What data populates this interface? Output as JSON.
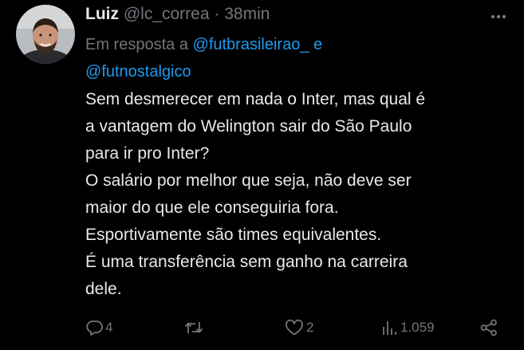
{
  "tweet": {
    "author_name": "Luiz",
    "author_handle": "@lc_correa",
    "separator": "·",
    "time": "38min",
    "reply_prefix": "Em resposta a",
    "reply_mention_1": "@futbrasileirao_",
    "reply_conjunction": "e",
    "reply_mention_2": "@futnostalgico",
    "text_lines": [
      "Sem desmerecer em nada o Inter, mas qual é",
      "a vantagem do Welington sair do São Paulo",
      "para ir pro Inter?",
      "O salário por melhor que seja, não deve ser",
      "maior do que ele conseguiria fora.",
      "Esportivamente são times equivalentes.",
      "É uma transferência sem ganho na carreira",
      "dele."
    ]
  },
  "actions": {
    "replies": "4",
    "retweets": "",
    "likes": "2",
    "views": "1.059"
  },
  "icons": {
    "avatar": "profile-photo",
    "more": "more-dots-icon",
    "reply": "reply-icon",
    "retweet": "retweet-icon",
    "like": "heart-icon",
    "views": "views-chart-icon",
    "share": "share-icon"
  },
  "colors": {
    "background": "#000000",
    "text": "#e7e9ea",
    "muted": "#71767b",
    "accent": "#1d9bf0"
  }
}
